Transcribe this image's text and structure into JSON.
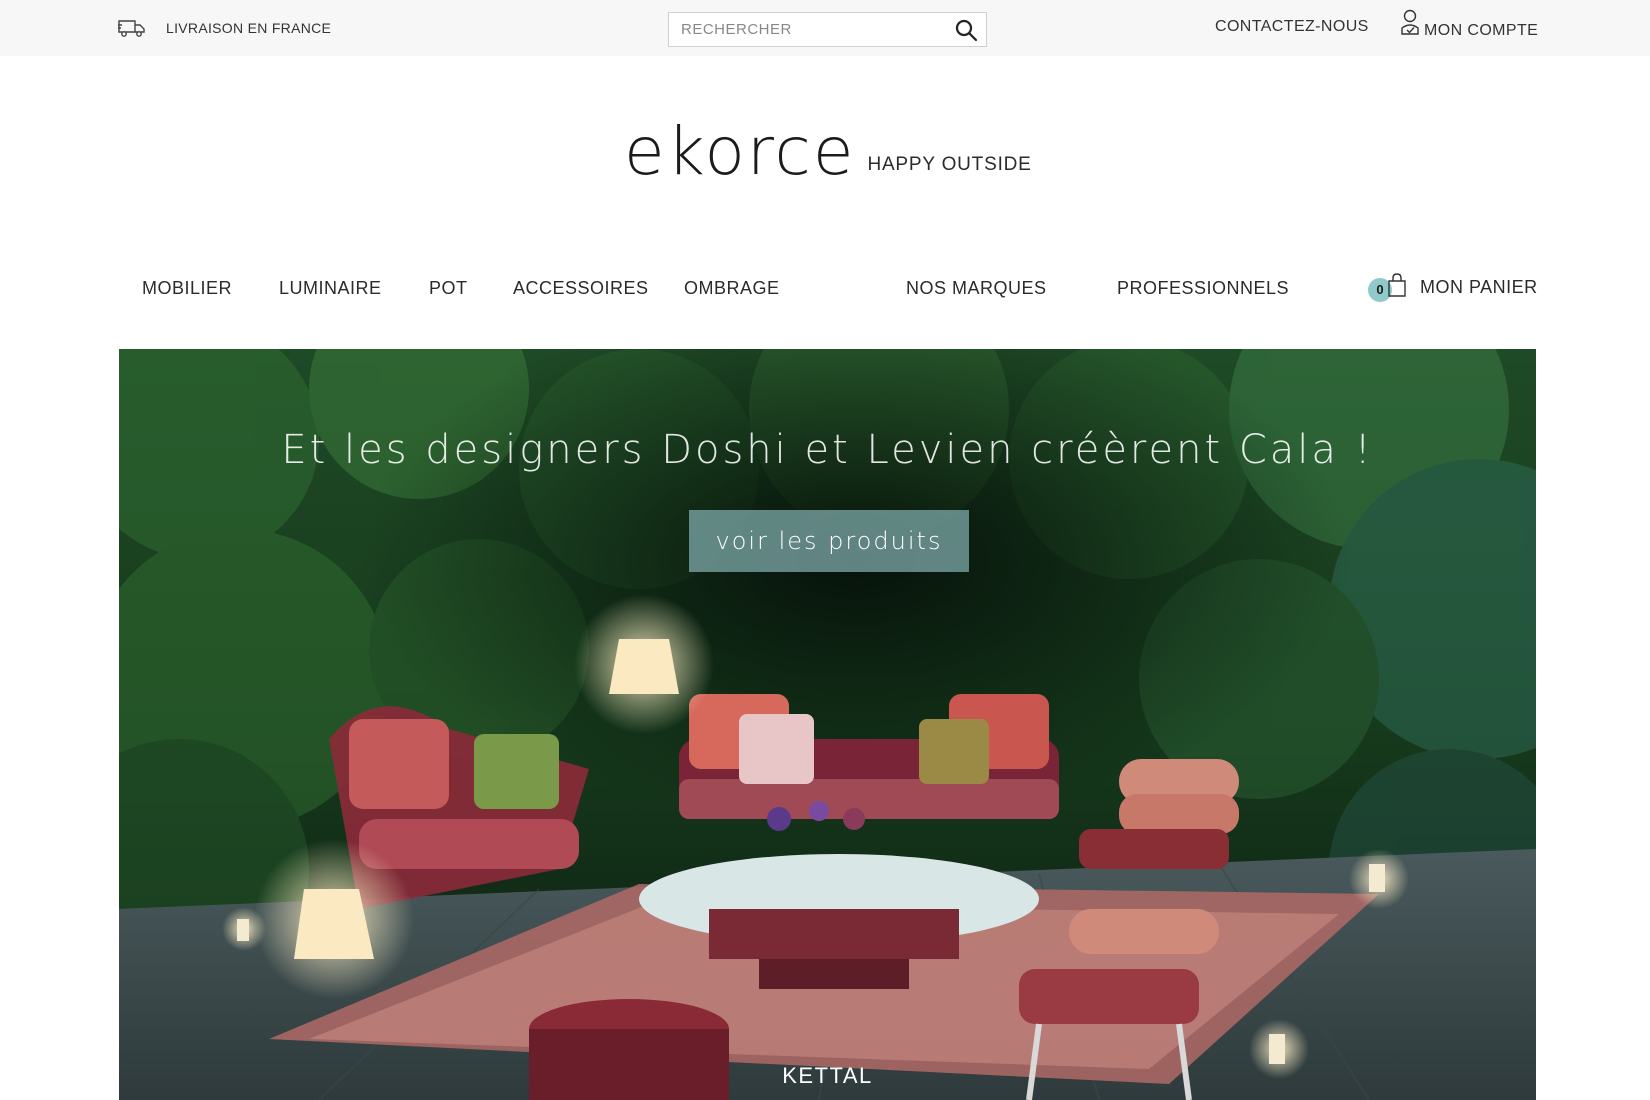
{
  "topbar": {
    "shipping_label": "LIVRAISON EN FRANCE",
    "search_placeholder": "RECHERCHER",
    "contact_label": "CONTACTEZ-NOUS",
    "account_label": "MON COMPTE"
  },
  "logo": {
    "wordmark": "ekorce",
    "tagline": "HAPPY OUTSIDE"
  },
  "nav": {
    "items": [
      "MOBILIER",
      "LUMINAIRE",
      "POT",
      "ACCESSOIRES",
      "OMBRAGE",
      "NOS MARQUES",
      "PROFESSIONNELS"
    ],
    "cart_count": "0",
    "cart_label": "MON PANIER"
  },
  "hero": {
    "headline": "Et les designers Doshi et Levien créèrent Cala !",
    "cta_label": "voir les produits",
    "brand": "KETTAL"
  },
  "colors": {
    "accent": "#8fc9c9",
    "cta_bg": "#7daaaa",
    "topbar_bg": "#f7f7f7"
  },
  "icons": {
    "shipping": "truck-icon",
    "search": "search-icon",
    "account": "user-icon",
    "cart": "shopping-bag-icon"
  }
}
